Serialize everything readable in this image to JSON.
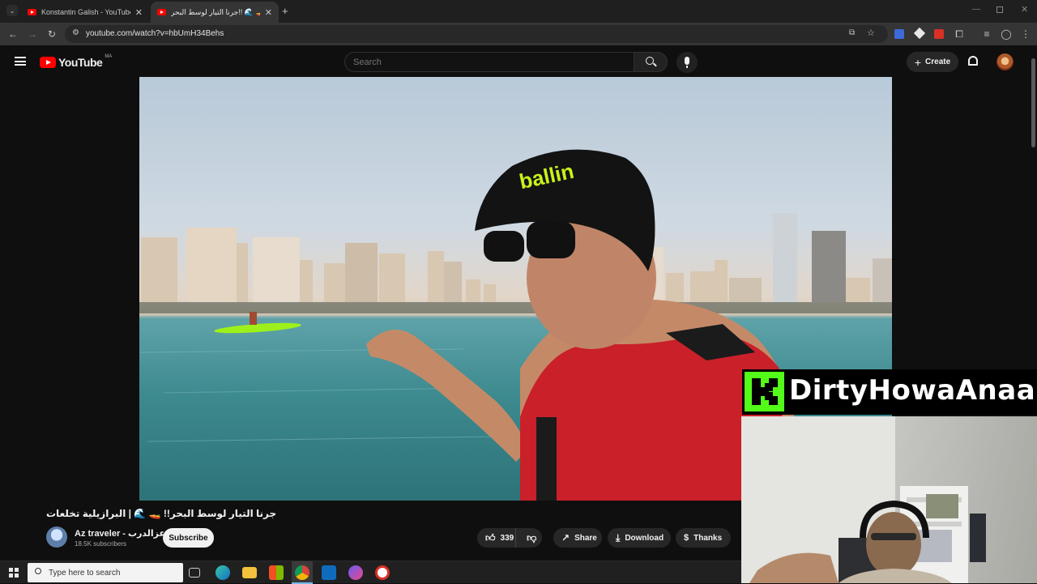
{
  "browser": {
    "tabs": [
      {
        "title": "Konstantin Galish - YouTube",
        "active": false
      },
      {
        "title": "جرنا التيار لوسط البحر!! 🌊 🚤",
        "active": true
      }
    ],
    "address": "youtube.com/watch?v=hbUmH34Behs"
  },
  "youtube": {
    "logo_text": "YouTube",
    "country_code": "MA",
    "search_placeholder": "Search",
    "create_label": "Create"
  },
  "video": {
    "title": "جرنا التيار لوسط البحر!! 🚤 🌊 | البرازيلية تخلعات",
    "channel_name": "Az traveler - عزالدرب",
    "subscribers": "18.5K subscribers",
    "subscribe_label": "Subscribe",
    "likes": "339",
    "share_label": "Share",
    "download_label": "Download",
    "thanks_label": "Thanks",
    "hat_text": "ballin"
  },
  "overlay": {
    "streamer_name": "DirtyHowaAnaa"
  },
  "taskbar": {
    "search_placeholder": "Type here to search"
  },
  "colors": {
    "youtube_red": "#ff0000",
    "kick_green": "#53fc18",
    "background": "#0f0f0f"
  }
}
